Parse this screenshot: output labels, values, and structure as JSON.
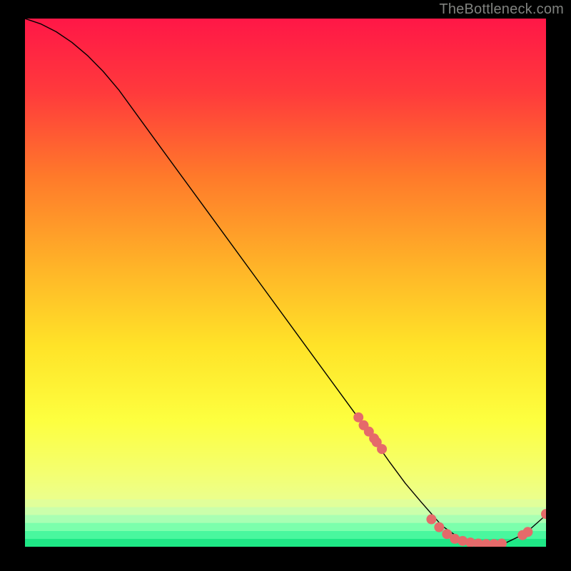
{
  "watermark": "TheBottleneck.com",
  "chart_data": {
    "type": "line",
    "title": "",
    "xlabel": "",
    "ylabel": "",
    "xlim": [
      0,
      100
    ],
    "ylim": [
      0,
      100
    ],
    "grid": false,
    "series": [
      {
        "name": "curve",
        "x": [
          0,
          3,
          6,
          9,
          12,
          15,
          18,
          25,
          35,
          45,
          55,
          65,
          70,
          73,
          76,
          80,
          84,
          88,
          92,
          96,
          100
        ],
        "y": [
          100,
          99,
          97.5,
          95.5,
          93,
          90,
          86.5,
          77,
          63.5,
          50,
          36.5,
          23,
          16,
          12,
          8.5,
          4,
          1.2,
          0.4,
          0.6,
          2.5,
          6
        ],
        "style": "line",
        "color": "#000000",
        "stroke_width": 1.4
      },
      {
        "name": "dots",
        "x": [
          64,
          65,
          66,
          67,
          67.5,
          68.5,
          78,
          79.5,
          81,
          82.5,
          84,
          85.5,
          87,
          88.5,
          90,
          91.5,
          95.5,
          96.5,
          100
        ],
        "y": [
          24.5,
          23,
          21.8,
          20.5,
          19.8,
          18.5,
          5.2,
          3.7,
          2.4,
          1.5,
          1.1,
          0.8,
          0.6,
          0.5,
          0.5,
          0.6,
          2.2,
          2.8,
          6.2
        ],
        "style": "scatter",
        "color": "#e56a6a",
        "marker_size": 7
      }
    ],
    "background_gradient": {
      "top_color": "#ff1747",
      "mid_upper_color": "#ff8b27",
      "mid_color": "#ffe728",
      "mid_lower_color": "#f4ff5e",
      "band_colors": [
        "#e9ff87",
        "#cfffad",
        "#9bffb7",
        "#56f7a0",
        "#1fe886"
      ]
    }
  }
}
